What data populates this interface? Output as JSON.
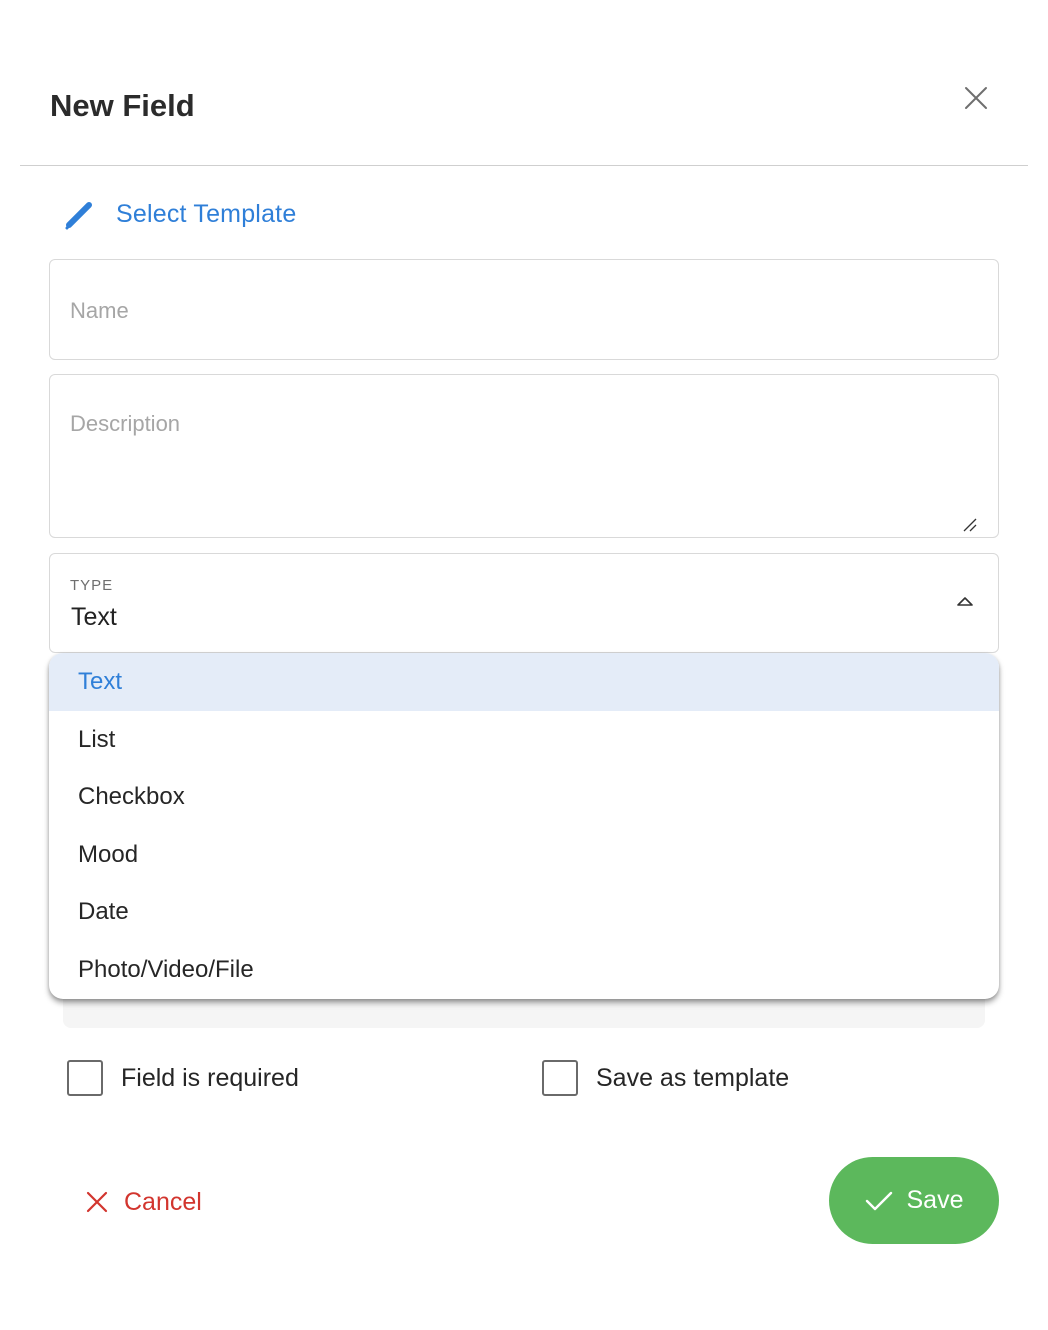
{
  "dialog": {
    "title": "New Field",
    "close_icon": "close-icon"
  },
  "template_link": {
    "icon": "pencil-icon",
    "label": "Select Template"
  },
  "form": {
    "name_placeholder": "Name",
    "name_value": "",
    "description_placeholder": "Description",
    "description_value": "",
    "type_label": "TYPE",
    "type_value": "Text",
    "type_chevron_icon": "chevron-up-icon"
  },
  "type_menu": {
    "selected": "Text",
    "items": [
      "Text",
      "List",
      "Checkbox",
      "Mood",
      "Date",
      "Photo/Video/File"
    ]
  },
  "options": {
    "required_label": "Field is required",
    "required_checked": false,
    "save_template_label": "Save as template",
    "save_template_checked": false
  },
  "actions": {
    "cancel_label": "Cancel",
    "cancel_icon": "close-icon",
    "save_label": "Save",
    "save_icon": "check-icon"
  },
  "colors": {
    "accent": "#2f7fd8",
    "danger": "#d2352e",
    "success": "#5cb85c",
    "selected_bg": "#e4ecf8"
  }
}
